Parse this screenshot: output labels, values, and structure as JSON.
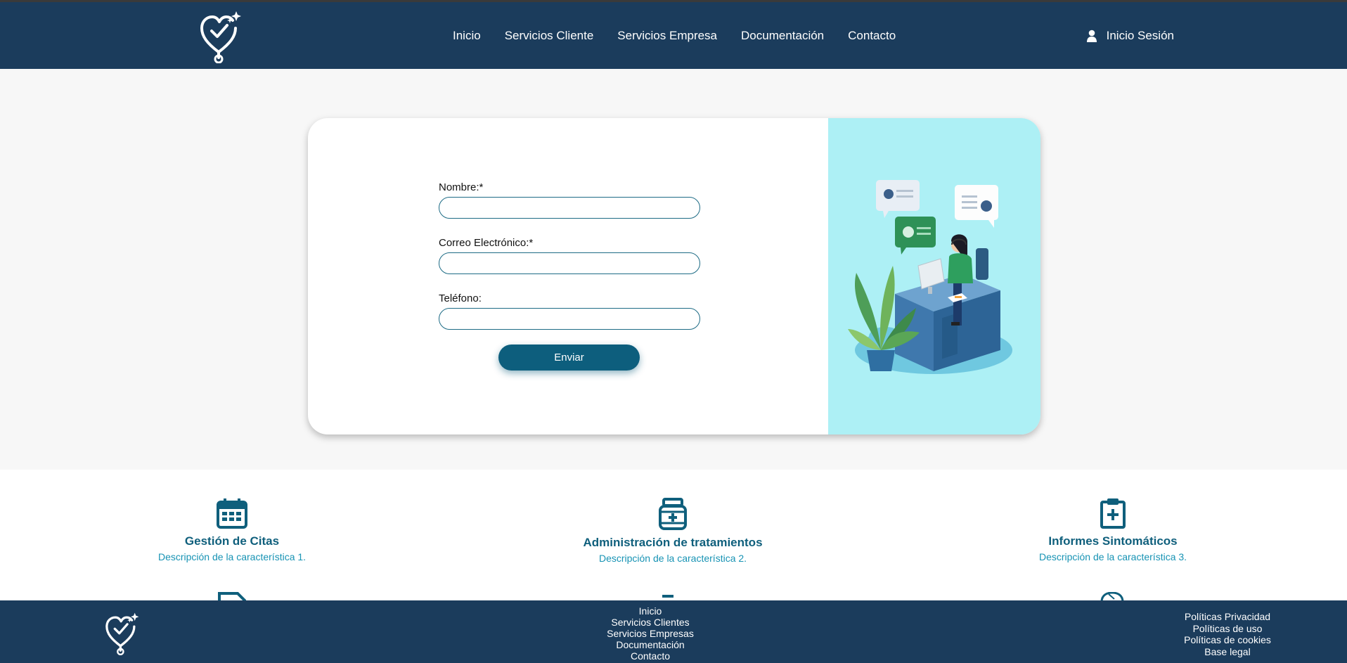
{
  "header": {
    "nav": [
      "Inicio",
      "Servicios Cliente",
      "Servicios Empresa",
      "Documentación",
      "Contacto"
    ],
    "login_label": "Inicio Sesión"
  },
  "form": {
    "name_label": "Nombre:*",
    "name_value": "",
    "email_label": "Correo Electrónico:*",
    "email_value": "",
    "phone_label": "Teléfono:",
    "phone_value": "",
    "submit_label": "Enviar"
  },
  "features": [
    {
      "icon": "calendar-icon",
      "title": "Gestión de Citas",
      "description": "Descripción de la característica 1."
    },
    {
      "icon": "medicine-jar-icon",
      "title": "Administración de tratamientos",
      "description": "Descripción de la característica 2."
    },
    {
      "icon": "clipboard-medical-icon",
      "title": "Informes Sintomáticos",
      "description": "Descripción de la característica 3."
    }
  ],
  "footer": {
    "nav": [
      "Inicio",
      "Servicios Clientes",
      "Servicios Empresas",
      "Documentación",
      "Contacto"
    ],
    "legal": [
      "Políticas Privacidad",
      "Políticas de uso",
      "Políticas de cookies",
      "Base legal"
    ]
  },
  "colors": {
    "header_bg": "#1b3c5c",
    "accent": "#0d5e7d",
    "illustration_bg": "#adf0f5",
    "feature_title": "#0f5f7c",
    "feature_text": "#1793b4"
  }
}
